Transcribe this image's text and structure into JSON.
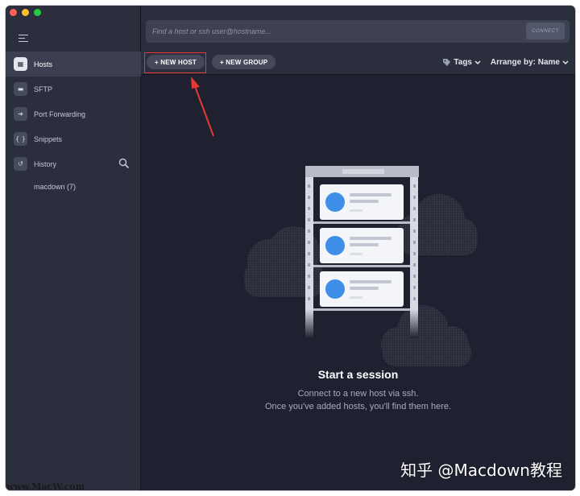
{
  "sidebar": {
    "items": [
      {
        "label": "Hosts",
        "icon": "hosts-icon",
        "glyph": "▦"
      },
      {
        "label": "SFTP",
        "icon": "folder-icon",
        "glyph": "▬"
      },
      {
        "label": "Port Forwarding",
        "icon": "forward-icon",
        "glyph": "➜"
      },
      {
        "label": "Snippets",
        "icon": "braces-icon",
        "glyph": "{ }"
      },
      {
        "label": "History",
        "icon": "history-icon",
        "glyph": "↺"
      }
    ],
    "history_entry": "macdown (7)"
  },
  "search": {
    "placeholder": "Find a host or ssh user@hostname...",
    "connect_label": "CONNECT"
  },
  "toolbar": {
    "new_host": "+ NEW HOST",
    "new_group": "+ NEW GROUP",
    "tags": "Tags",
    "arrange": "Arrange by: Name"
  },
  "empty_state": {
    "title": "Start a session",
    "line1": "Connect to a new host via ssh.",
    "line2": "Once you've added hosts, you'll find them here."
  },
  "watermarks": {
    "zhihu": "知乎 @Macdown教程",
    "site": "www.MacW.com"
  },
  "colors": {
    "accent_red": "#e53935",
    "sidebar_bg": "#2b2e3d",
    "main_bg": "#1f2130",
    "avatar_blue": "#3f8ee8"
  }
}
